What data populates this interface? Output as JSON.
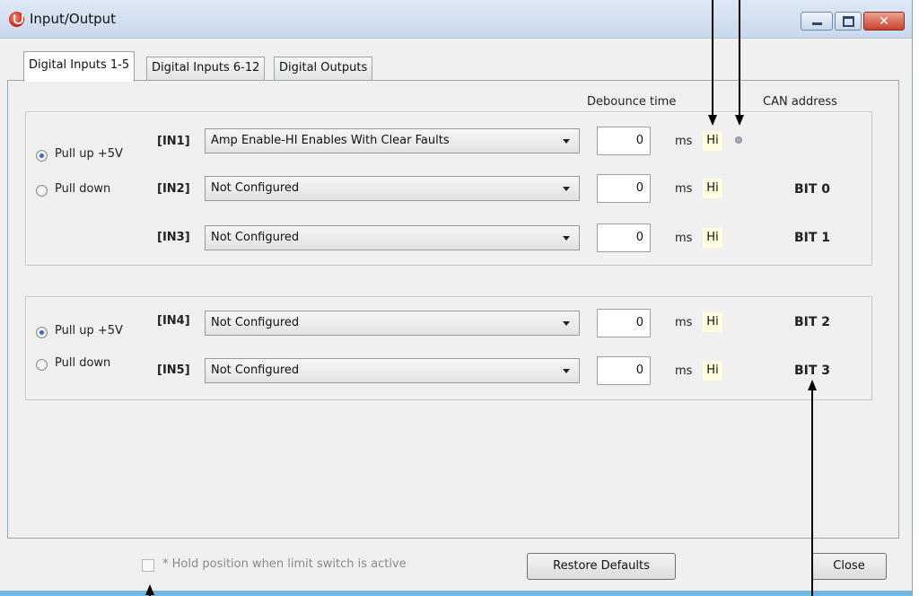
{
  "window": {
    "title": "Input/Output",
    "minimize_icon": "minimize-icon",
    "maximize_icon": "maximize-icon",
    "close_icon": "close-icon"
  },
  "tabs": [
    {
      "label": "Digital Inputs 1-5",
      "active": true
    },
    {
      "label": "Digital Inputs 6-12",
      "active": false
    },
    {
      "label": "Digital Outputs",
      "active": false
    }
  ],
  "headers": {
    "debounce": "Debounce time",
    "can_address": "CAN address"
  },
  "group1": {
    "pull_up_label": "Pull up +5V",
    "pull_down_label": "Pull down",
    "selected": "pull_up",
    "rows": [
      {
        "label": "[IN1]",
        "function": "Amp Enable-HI Enables With Clear Faults",
        "debounce": "0",
        "unit": "ms",
        "state": "Hi",
        "can": ""
      },
      {
        "label": "[IN2]",
        "function": "Not Configured",
        "debounce": "0",
        "unit": "ms",
        "state": "Hi",
        "can": "BIT 0"
      },
      {
        "label": "[IN3]",
        "function": "Not Configured",
        "debounce": "0",
        "unit": "ms",
        "state": "Hi",
        "can": "BIT 1"
      }
    ]
  },
  "group2": {
    "pull_up_label": "Pull up +5V",
    "pull_down_label": "Pull down",
    "selected": "pull_up",
    "rows": [
      {
        "label": "[IN4]",
        "function": "Not Configured",
        "debounce": "0",
        "unit": "ms",
        "state": "Hi",
        "can": "BIT 2"
      },
      {
        "label": "[IN5]",
        "function": "Not Configured",
        "debounce": "0",
        "unit": "ms",
        "state": "Hi",
        "can": "BIT 3"
      }
    ]
  },
  "footer": {
    "hold_checkbox_label": "* Hold position when limit switch is active",
    "hold_checked": false,
    "restore_label": "Restore Defaults",
    "close_label": "Close"
  },
  "colors": {
    "state_bg": "#fffde0",
    "title_bar": "#c9d9ec",
    "close_button": "#c8432b"
  }
}
